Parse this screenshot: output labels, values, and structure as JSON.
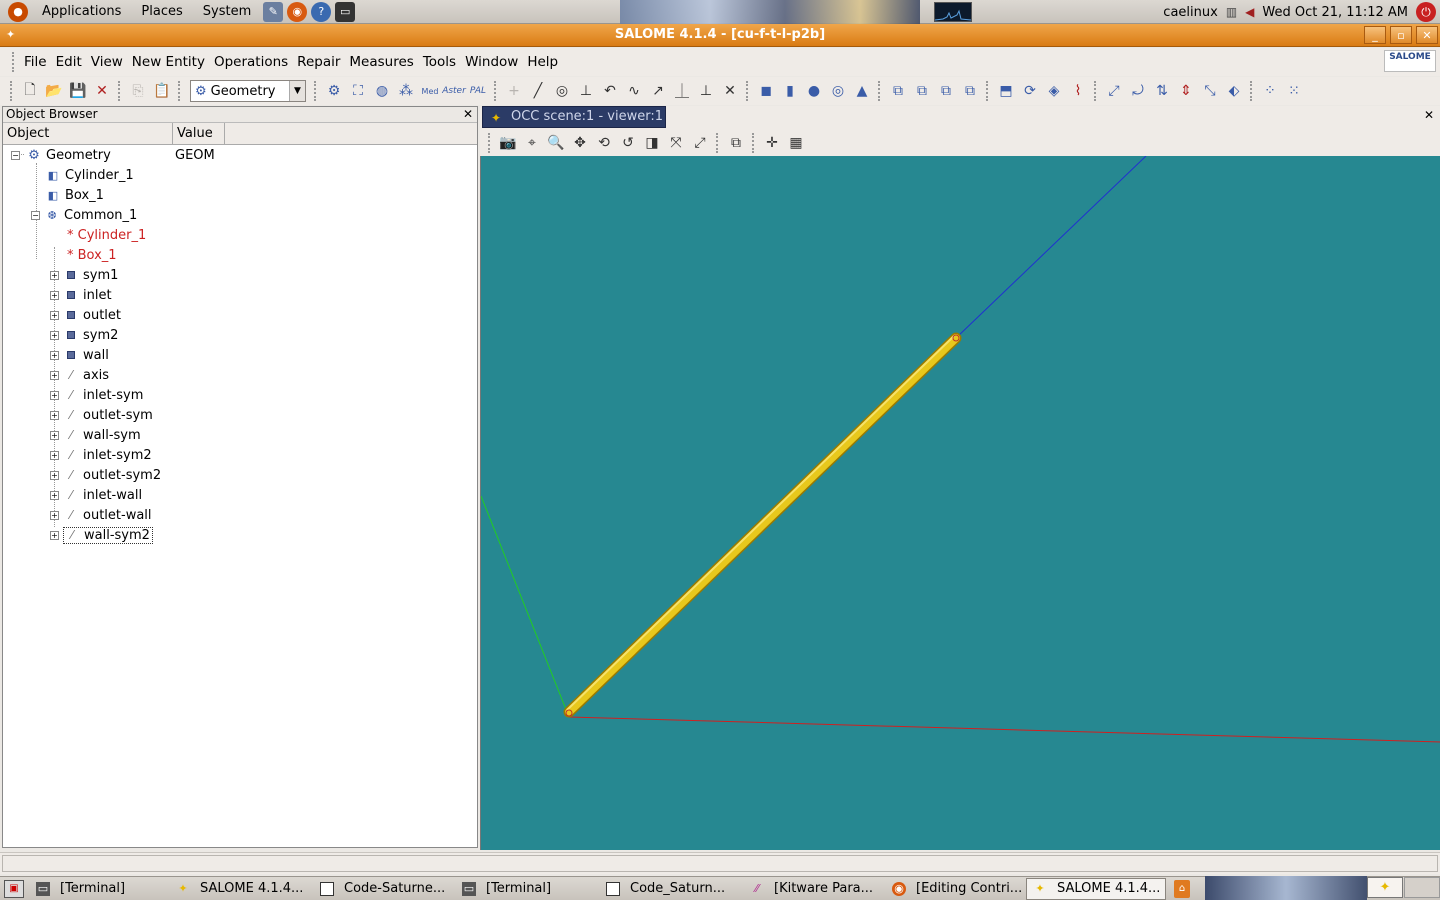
{
  "top_panel": {
    "menus": [
      "Applications",
      "Places",
      "System"
    ],
    "username": "caelinux",
    "clock": "Wed Oct 21, 11:12 AM"
  },
  "window": {
    "title": "SALOME 4.1.4 - [cu-f-t-l-p2b]",
    "buttons": [
      "_",
      "▫",
      "✕"
    ]
  },
  "menubar": [
    "File",
    "Edit",
    "View",
    "New Entity",
    "Operations",
    "Repair",
    "Measures",
    "Tools",
    "Window",
    "Help"
  ],
  "salome_logo": "SALOME",
  "toolbar": {
    "module_select": "Geometry"
  },
  "object_browser": {
    "title": "Object Browser",
    "columns": [
      "Object",
      "Value"
    ],
    "root": {
      "label": "Geometry",
      "value": "GEOM"
    },
    "items": [
      {
        "label": "Cylinder_1"
      },
      {
        "label": "Box_1"
      },
      {
        "label": "Common_1"
      }
    ],
    "children": [
      {
        "label": "* Cylinder_1"
      },
      {
        "label": "* Box_1"
      },
      {
        "label": "sym1"
      },
      {
        "label": "inlet"
      },
      {
        "label": "outlet"
      },
      {
        "label": "sym2"
      },
      {
        "label": "wall"
      },
      {
        "label": "axis"
      },
      {
        "label": "inlet-sym"
      },
      {
        "label": "outlet-sym"
      },
      {
        "label": "wall-sym"
      },
      {
        "label": "inlet-sym2"
      },
      {
        "label": "outlet-sym2"
      },
      {
        "label": "inlet-wall"
      },
      {
        "label": "outlet-wall"
      },
      {
        "label": "wall-sym2"
      }
    ]
  },
  "viewer": {
    "tab_label": "OCC scene:1 - viewer:1",
    "background": "#268891",
    "axis_colors": {
      "x": "#d02020",
      "y": "#20c020",
      "z": "#2030d0"
    },
    "shape_color": "#e8c81c"
  },
  "taskbar": {
    "tasks": [
      "[Terminal]",
      "SALOME 4.1.4...",
      "Code-Saturne...",
      "[Terminal]",
      "Code_Saturn...",
      "[Kitware Para...",
      "[Editing Contri...",
      "SALOME 4.1.4..."
    ]
  }
}
